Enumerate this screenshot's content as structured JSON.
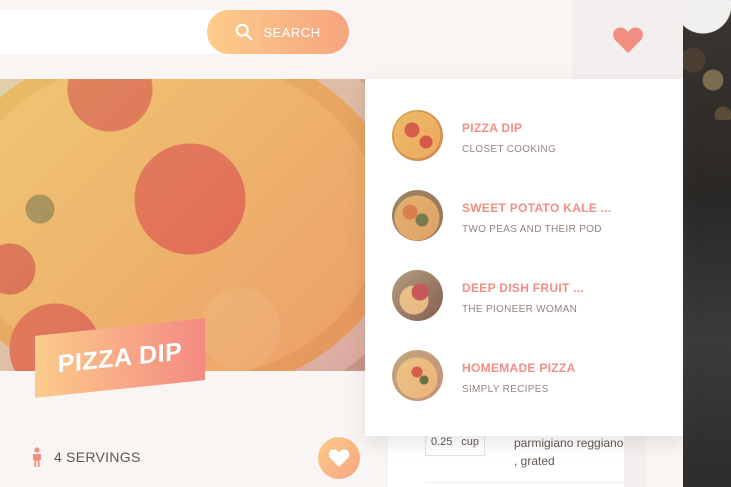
{
  "header": {
    "search": {
      "value": "",
      "placeholder": ""
    },
    "search_button_label": "SEARCH",
    "search_icon": "search-icon",
    "bookmarks_icon": "heart-icon",
    "accent_gradient": [
      "#fbcc8b",
      "#f7a47f"
    ]
  },
  "bookmarks": {
    "items": [
      {
        "title": "PIZZA DIP",
        "publisher": "CLOSET COOKING"
      },
      {
        "title": "SWEET POTATO KALE ...",
        "publisher": "TWO PEAS AND THEIR POD"
      },
      {
        "title": "DEEP DISH FRUIT ...",
        "publisher": "THE PIONEER WOMAN"
      },
      {
        "title": "HOMEMADE PIZZA",
        "publisher": "SIMPLY RECIPES"
      }
    ],
    "title_color": "#f38e82",
    "publisher_color": "#918581"
  },
  "recipe": {
    "title": "PIZZA DIP",
    "servings_count": "4",
    "servings_label": "SERVINGS",
    "servings_icon": "person-icon",
    "bookmark_icon": "heart-icon"
  },
  "ingredients": {
    "first": {
      "quantity": "0.25",
      "unit": "cup",
      "description": "parmigiano reggiano , grated"
    }
  }
}
